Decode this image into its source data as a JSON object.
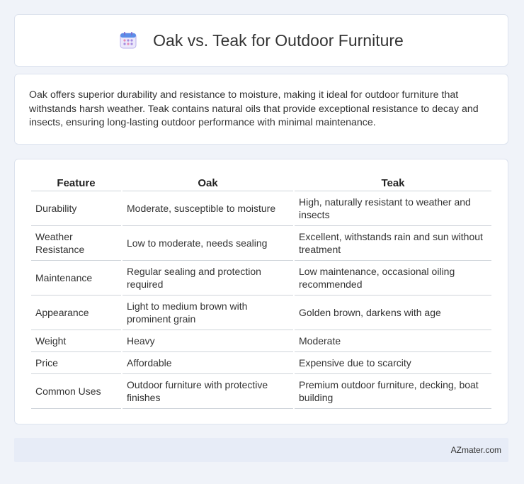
{
  "header": {
    "title": "Oak vs. Teak for Outdoor Furniture",
    "icon": "calendar-icon",
    "icon_color": "#8a7fd6"
  },
  "intro": {
    "text": "Oak offers superior durability and resistance to moisture, making it ideal for outdoor furniture that withstands harsh weather. Teak contains natural oils that provide exceptional resistance to decay and insects, ensuring long-lasting outdoor performance with minimal maintenance."
  },
  "table": {
    "headers": [
      "Feature",
      "Oak",
      "Teak"
    ],
    "rows": [
      [
        "Durability",
        "Moderate, susceptible to moisture",
        "High, naturally resistant to weather and insects"
      ],
      [
        "Weather Resistance",
        "Low to moderate, needs sealing",
        "Excellent, withstands rain and sun without treatment"
      ],
      [
        "Maintenance",
        "Regular sealing and protection required",
        "Low maintenance, occasional oiling recommended"
      ],
      [
        "Appearance",
        "Light to medium brown with prominent grain",
        "Golden brown, darkens with age"
      ],
      [
        "Weight",
        "Heavy",
        "Moderate"
      ],
      [
        "Price",
        "Affordable",
        "Expensive due to scarcity"
      ],
      [
        "Common Uses",
        "Outdoor furniture with protective finishes",
        "Premium outdoor furniture, decking, boat building"
      ]
    ]
  },
  "footer": {
    "text": "AZmater.com"
  }
}
